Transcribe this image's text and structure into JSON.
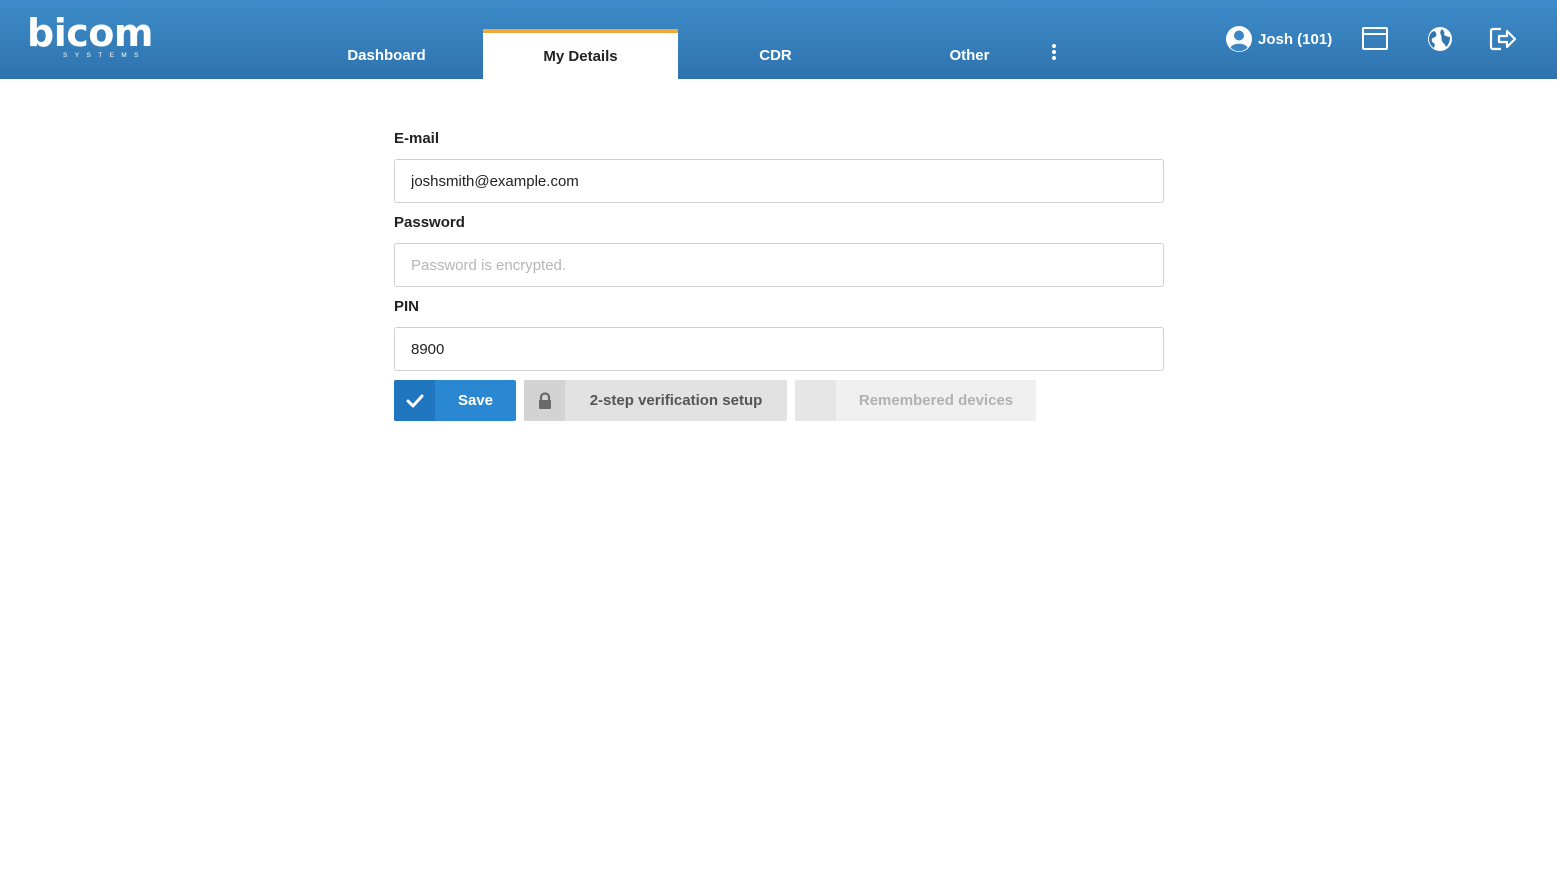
{
  "brand": {
    "name": "bicom",
    "tagline": "SYSTEMS"
  },
  "nav": {
    "tabs": [
      {
        "label": "Dashboard",
        "active": false
      },
      {
        "label": "My Details",
        "active": true
      },
      {
        "label": "CDR",
        "active": false
      },
      {
        "label": "Other",
        "active": false
      }
    ],
    "more_icon": "vertical-ellipsis-icon"
  },
  "user": {
    "label": "Josh (101)",
    "icon": "user-circle-icon"
  },
  "toolbar_icons": [
    "window-icon",
    "globe-icon",
    "logout-icon"
  ],
  "form": {
    "email": {
      "label": "E-mail",
      "value": "joshsmith@example.com"
    },
    "password": {
      "label": "Password",
      "value": "",
      "placeholder": "Password is encrypted."
    },
    "pin": {
      "label": "PIN",
      "value": "8900"
    }
  },
  "actions": {
    "save_label": "Save",
    "two_step_label": "2-step verification setup",
    "remembered_devices_label": "Remembered devices"
  },
  "colors": {
    "header_top": "#3d8cc9",
    "header_bottom": "#2f73ae",
    "active_tab_accent": "#f2a93b",
    "primary_button": "#2a88d3"
  }
}
